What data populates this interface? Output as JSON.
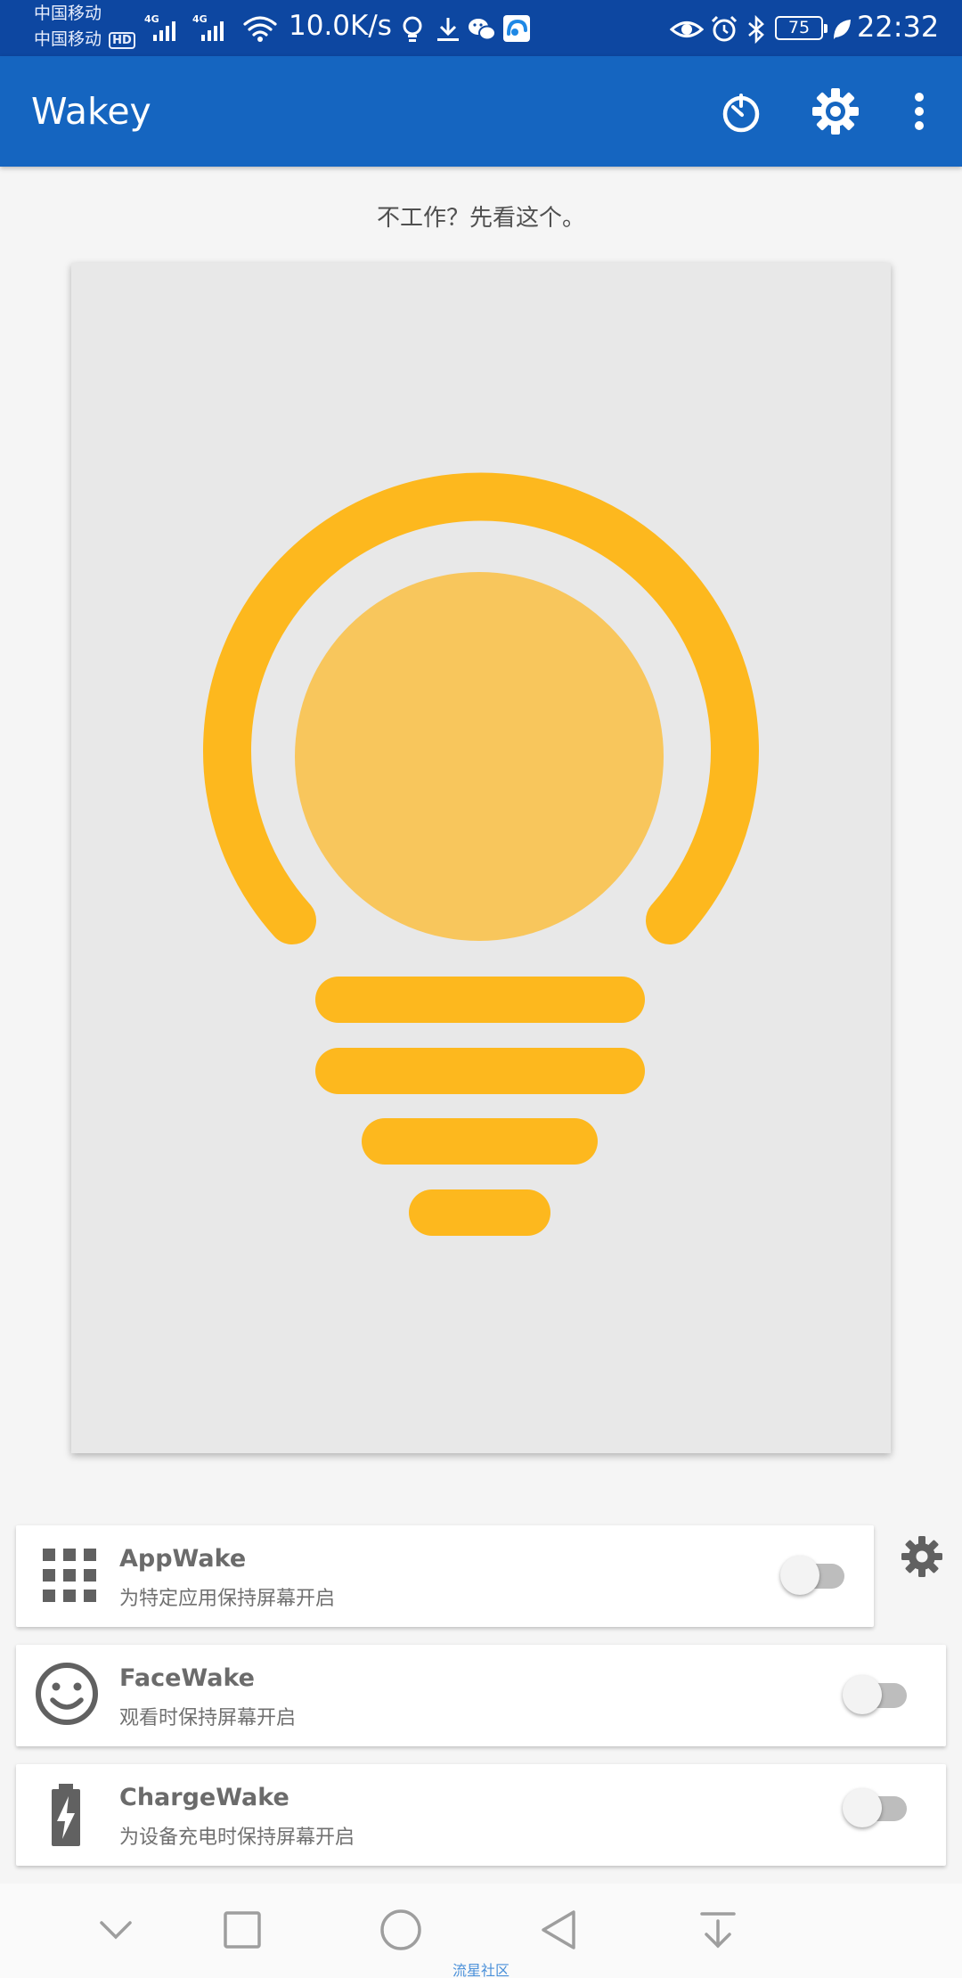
{
  "status_bar": {
    "carrier_1": "中国移动",
    "carrier_2": "中国移动",
    "hd_badge": "HD",
    "net_type_1": "4G",
    "net_type_2": "4G",
    "speed": "10.0K/s",
    "battery": "75",
    "time": "22:32"
  },
  "app_bar": {
    "title": "Wakey"
  },
  "hint": "不工作？先看这个。",
  "wake_items": [
    {
      "title": "AppWake",
      "subtitle": "为特定应用保持屏幕开启",
      "enabled": false
    },
    {
      "title": "FaceWake",
      "subtitle": "观看时保持屏幕开启",
      "enabled": false
    },
    {
      "title": "ChargeWake",
      "subtitle": "为设备充电时保持屏幕开启",
      "enabled": false
    }
  ],
  "watermark": "流星社区",
  "colors": {
    "status_bar": "#0d47a1",
    "app_bar": "#1565c0",
    "bulb_outline": "#fdb81e",
    "bulb_core": "#f8c65c",
    "card_bg": "#e8e8e8"
  }
}
